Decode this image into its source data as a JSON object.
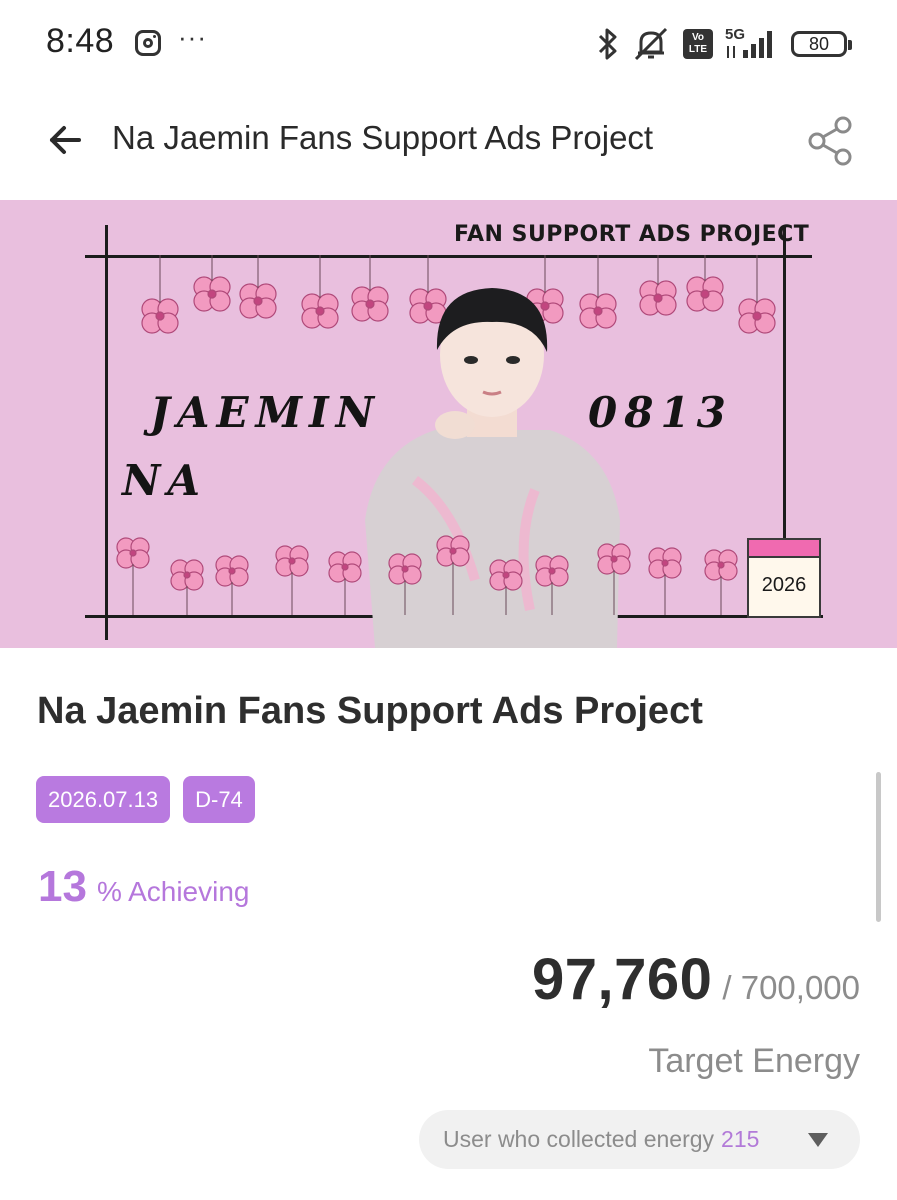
{
  "status_bar": {
    "time": "8:48",
    "more": "···",
    "battery": "80",
    "network": "5G",
    "volte": "Vo LTE",
    "icons": [
      "instagram-icon",
      "bluetooth-icon",
      "mute-icon",
      "volte-icon",
      "signal-icon",
      "battery-icon"
    ]
  },
  "header": {
    "title": "Na Jaemin Fans Support Ads Project",
    "back_icon": "arrow-left-icon",
    "share_icon": "share-icon"
  },
  "banner": {
    "title": "FAN SUPPORT ADS PROJECT",
    "name_first": "JAEMIN",
    "name_last": "NA",
    "birthday": "0813",
    "calendar_year": "2026",
    "background": "#e9bfde"
  },
  "project": {
    "title": "Na Jaemin Fans Support Ads Project",
    "tags": [
      "2026.07.13",
      "D-74"
    ],
    "achieving_percent": "13",
    "achieving_label": "% Achieving",
    "energy_current": "97,760",
    "energy_target": "/ 700,000",
    "target_label": "Target Energy",
    "collectors_label": "User who collected energy",
    "collectors_count": "215"
  },
  "colors": {
    "accent": "#b97ae0",
    "accent_text": "#b577dc",
    "muted": "#8c8c8c"
  }
}
